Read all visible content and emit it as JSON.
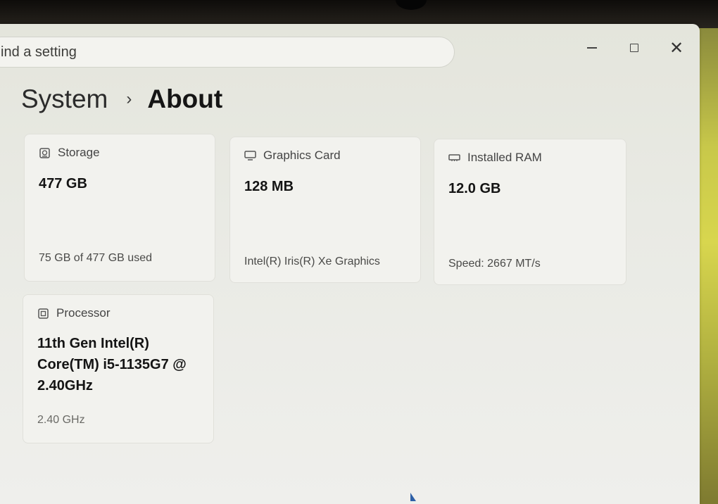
{
  "search": {
    "text": "ind a setting"
  },
  "breadcrumb": {
    "parent": "System",
    "separator": "›",
    "current": "About"
  },
  "window_controls": {
    "close_glyph": "✕"
  },
  "cards": {
    "storage": {
      "title": "Storage",
      "icon": "storage-drive-icon",
      "value": "477 GB",
      "detail": "75 GB of 477 GB used"
    },
    "graphics": {
      "title": "Graphics Card",
      "icon": "monitor-icon",
      "value": "128 MB",
      "detail": "Intel(R) Iris(R) Xe Graphics"
    },
    "ram": {
      "title": "Installed RAM",
      "icon": "memory-chip-icon",
      "value": "12.0 GB",
      "detail": "Speed: 2667 MT/s"
    },
    "processor": {
      "title": "Processor",
      "icon": "processor-icon",
      "value_lines": [
        "11th Gen Intel(R)",
        "Core(TM) i5-1135G7 @",
        "2.40GHz"
      ],
      "detail": "2.40 GHz"
    }
  }
}
